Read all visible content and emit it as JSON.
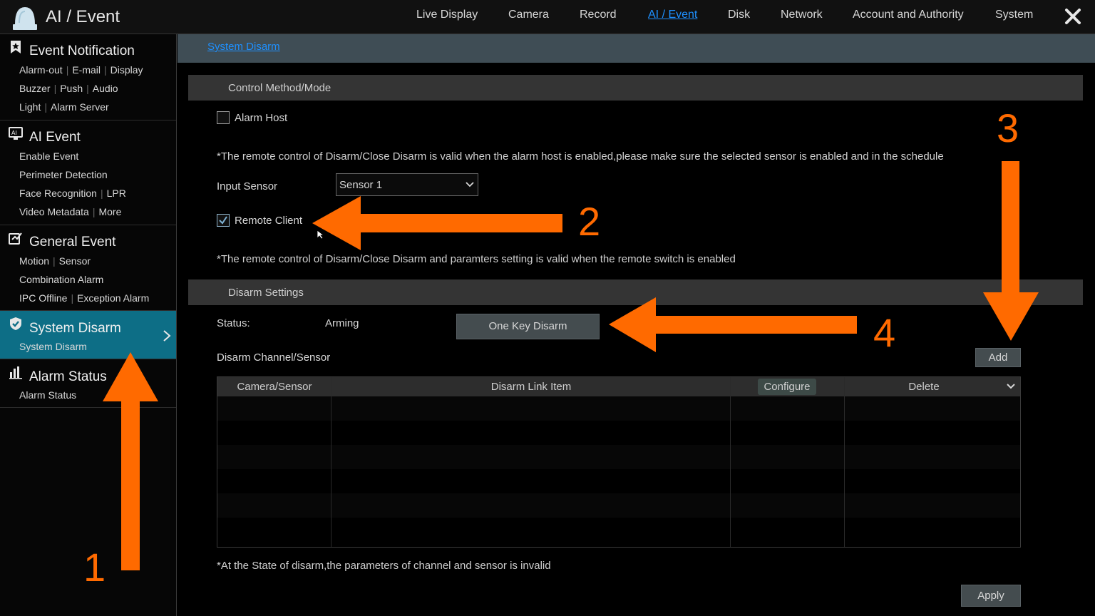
{
  "header": {
    "title": "AI / Event",
    "nav": [
      "Live Display",
      "Camera",
      "Record",
      "AI / Event",
      "Disk",
      "Network",
      "Account and Authority",
      "System"
    ],
    "active_nav": "AI / Event"
  },
  "sidebar": {
    "event_notification": {
      "title": "Event Notification",
      "rows": [
        [
          "Alarm-out",
          "E-mail",
          "Display"
        ],
        [
          "Buzzer",
          "Push",
          "Audio"
        ],
        [
          "Light",
          "Alarm Server"
        ]
      ]
    },
    "ai_event": {
      "title": "AI Event",
      "rows": [
        [
          "Enable Event"
        ],
        [
          "Perimeter Detection"
        ],
        [
          "Face Recognition",
          "LPR"
        ],
        [
          "Video Metadata",
          "More"
        ]
      ]
    },
    "general_event": {
      "title": "General Event",
      "rows": [
        [
          "Motion",
          "Sensor"
        ],
        [
          "Combination Alarm"
        ],
        [
          "IPC Offline",
          "Exception Alarm"
        ]
      ]
    },
    "system_disarm": {
      "title": "System Disarm",
      "rows": [
        [
          "System Disarm"
        ]
      ]
    },
    "alarm_status": {
      "title": "Alarm Status",
      "rows": [
        [
          "Alarm Status"
        ]
      ]
    }
  },
  "breadcrumb": "System Disarm",
  "control": {
    "header": "Control Method/Mode",
    "alarm_host_label": "Alarm Host",
    "alarm_host_checked": false,
    "note1": "*The remote control of Disarm/Close Disarm is valid when the alarm host is enabled,please make sure the selected sensor is enabled and in the schedule",
    "input_sensor_label": "Input Sensor",
    "input_sensor_value": "Sensor 1",
    "remote_client_label": "Remote Client",
    "remote_client_checked": true,
    "note2": "*The remote control of Disarm/Close Disarm and paramters setting is valid when the remote switch is enabled"
  },
  "disarm": {
    "header": "Disarm Settings",
    "status_label": "Status:",
    "status_value": "Arming",
    "one_key_label": "One Key Disarm",
    "channel_label": "Disarm Channel/Sensor",
    "add_label": "Add",
    "columns": [
      "Camera/Sensor",
      "Disarm Link Item",
      "Configure",
      "Delete"
    ],
    "note": "*At the State of disarm,the parameters of channel and sensor is invalid",
    "apply_label": "Apply"
  },
  "annotations": [
    "1",
    "2",
    "3",
    "4"
  ],
  "colors": {
    "accent": "#1e90ff",
    "active_sidebar": "#0d6e86",
    "annotation": "#ff6a00"
  }
}
